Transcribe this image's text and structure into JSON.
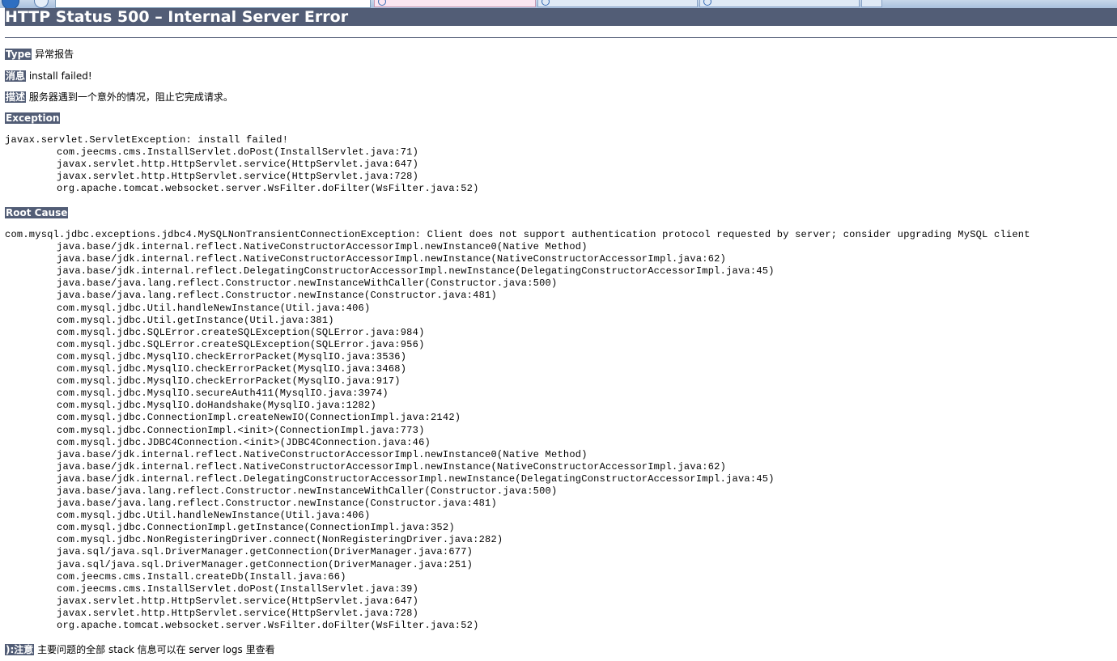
{
  "page": {
    "title": "HTTP Status 500 – Internal Server Error"
  },
  "type": {
    "label": "Type",
    "value": "异常报告"
  },
  "message": {
    "label": "消息",
    "value": "install failed!"
  },
  "description": {
    "label": "描述",
    "value": "服务器遇到一个意外的情况，阻止它完成请求。"
  },
  "exception": {
    "label": "Exception",
    "lines": [
      "javax.servlet.ServletException: install failed!",
      "com.jeecms.cms.InstallServlet.doPost(InstallServlet.java:71)",
      "javax.servlet.http.HttpServlet.service(HttpServlet.java:647)",
      "javax.servlet.http.HttpServlet.service(HttpServlet.java:728)",
      "org.apache.tomcat.websocket.server.WsFilter.doFilter(WsFilter.java:52)"
    ]
  },
  "root_cause": {
    "label": "Root Cause",
    "lines": [
      "com.mysql.jdbc.exceptions.jdbc4.MySQLNonTransientConnectionException: Client does not support authentication protocol requested by server; consider upgrading MySQL client",
      "java.base/jdk.internal.reflect.NativeConstructorAccessorImpl.newInstance0(Native Method)",
      "java.base/jdk.internal.reflect.NativeConstructorAccessorImpl.newInstance(NativeConstructorAccessorImpl.java:62)",
      "java.base/jdk.internal.reflect.DelegatingConstructorAccessorImpl.newInstance(DelegatingConstructorAccessorImpl.java:45)",
      "java.base/java.lang.reflect.Constructor.newInstanceWithCaller(Constructor.java:500)",
      "java.base/java.lang.reflect.Constructor.newInstance(Constructor.java:481)",
      "com.mysql.jdbc.Util.handleNewInstance(Util.java:406)",
      "com.mysql.jdbc.Util.getInstance(Util.java:381)",
      "com.mysql.jdbc.SQLError.createSQLException(SQLError.java:984)",
      "com.mysql.jdbc.SQLError.createSQLException(SQLError.java:956)",
      "com.mysql.jdbc.MysqlIO.checkErrorPacket(MysqlIO.java:3536)",
      "com.mysql.jdbc.MysqlIO.checkErrorPacket(MysqlIO.java:3468)",
      "com.mysql.jdbc.MysqlIO.checkErrorPacket(MysqlIO.java:917)",
      "com.mysql.jdbc.MysqlIO.secureAuth411(MysqlIO.java:3974)",
      "com.mysql.jdbc.MysqlIO.doHandshake(MysqlIO.java:1282)",
      "com.mysql.jdbc.ConnectionImpl.createNewIO(ConnectionImpl.java:2142)",
      "com.mysql.jdbc.ConnectionImpl.<init>(ConnectionImpl.java:773)",
      "com.mysql.jdbc.JDBC4Connection.<init>(JDBC4Connection.java:46)",
      "java.base/jdk.internal.reflect.NativeConstructorAccessorImpl.newInstance0(Native Method)",
      "java.base/jdk.internal.reflect.NativeConstructorAccessorImpl.newInstance(NativeConstructorAccessorImpl.java:62)",
      "java.base/jdk.internal.reflect.DelegatingConstructorAccessorImpl.newInstance(DelegatingConstructorAccessorImpl.java:45)",
      "java.base/java.lang.reflect.Constructor.newInstanceWithCaller(Constructor.java:500)",
      "java.base/java.lang.reflect.Constructor.newInstance(Constructor.java:481)",
      "com.mysql.jdbc.Util.handleNewInstance(Util.java:406)",
      "com.mysql.jdbc.ConnectionImpl.getInstance(ConnectionImpl.java:352)",
      "com.mysql.jdbc.NonRegisteringDriver.connect(NonRegisteringDriver.java:282)",
      "java.sql/java.sql.DriverManager.getConnection(DriverManager.java:677)",
      "java.sql/java.sql.DriverManager.getConnection(DriverManager.java:251)",
      "com.jeecms.cms.Install.createDb(Install.java:66)",
      "com.jeecms.cms.InstallServlet.doPost(InstallServlet.java:39)",
      "javax.servlet.http.HttpServlet.service(HttpServlet.java:647)",
      "javax.servlet.http.HttpServlet.service(HttpServlet.java:728)",
      "org.apache.tomcat.websocket.server.WsFilter.doFilter(WsFilter.java:52)"
    ]
  },
  "note": {
    "label": "):注意",
    "value": "主要问题的全部 stack 信息可以在 server logs 里查看"
  },
  "colors": {
    "header_bg": "#525d76",
    "header_text": "#ffffff"
  }
}
